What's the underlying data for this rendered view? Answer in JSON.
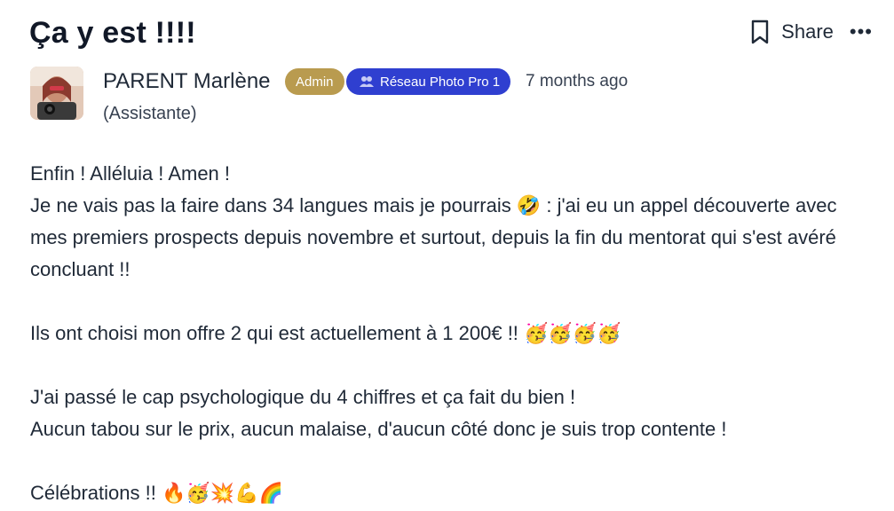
{
  "post": {
    "title": "Ça y est !!!!",
    "share_label": "Share",
    "more_label": "•••"
  },
  "author": {
    "name": "PARENT Marlène",
    "role": "(Assistante)",
    "admin_badge": "Admin",
    "space_badge": "Réseau Photo Pro 1",
    "timestamp": "7 months ago"
  },
  "content": {
    "line1": "Enfin ! Alléluia ! Amen !",
    "line2": "Je ne vais pas la faire dans 34 langues mais je pourrais 🤣 : j'ai eu un appel découverte avec mes premiers prospects depuis novembre et surtout, depuis la fin du mentorat qui s'est avéré concluant !!",
    "line3": "Ils ont choisi mon offre 2 qui est actuellement à 1 200€ !! 🥳🥳🥳🥳",
    "line4": "J'ai passé le cap psychologique du 4 chiffres et ça fait du bien !",
    "line5": "Aucun tabou sur le prix, aucun malaise, d'aucun côté donc je suis trop contente !",
    "line6": "Célébrations !! 🔥🥳💥💪🌈"
  },
  "colors": {
    "admin_badge": "#b99b4f",
    "space_badge": "#2f3fd0",
    "text": "#1f2937"
  },
  "icons": [
    "bookmark-icon",
    "more-icon",
    "group-icon"
  ]
}
